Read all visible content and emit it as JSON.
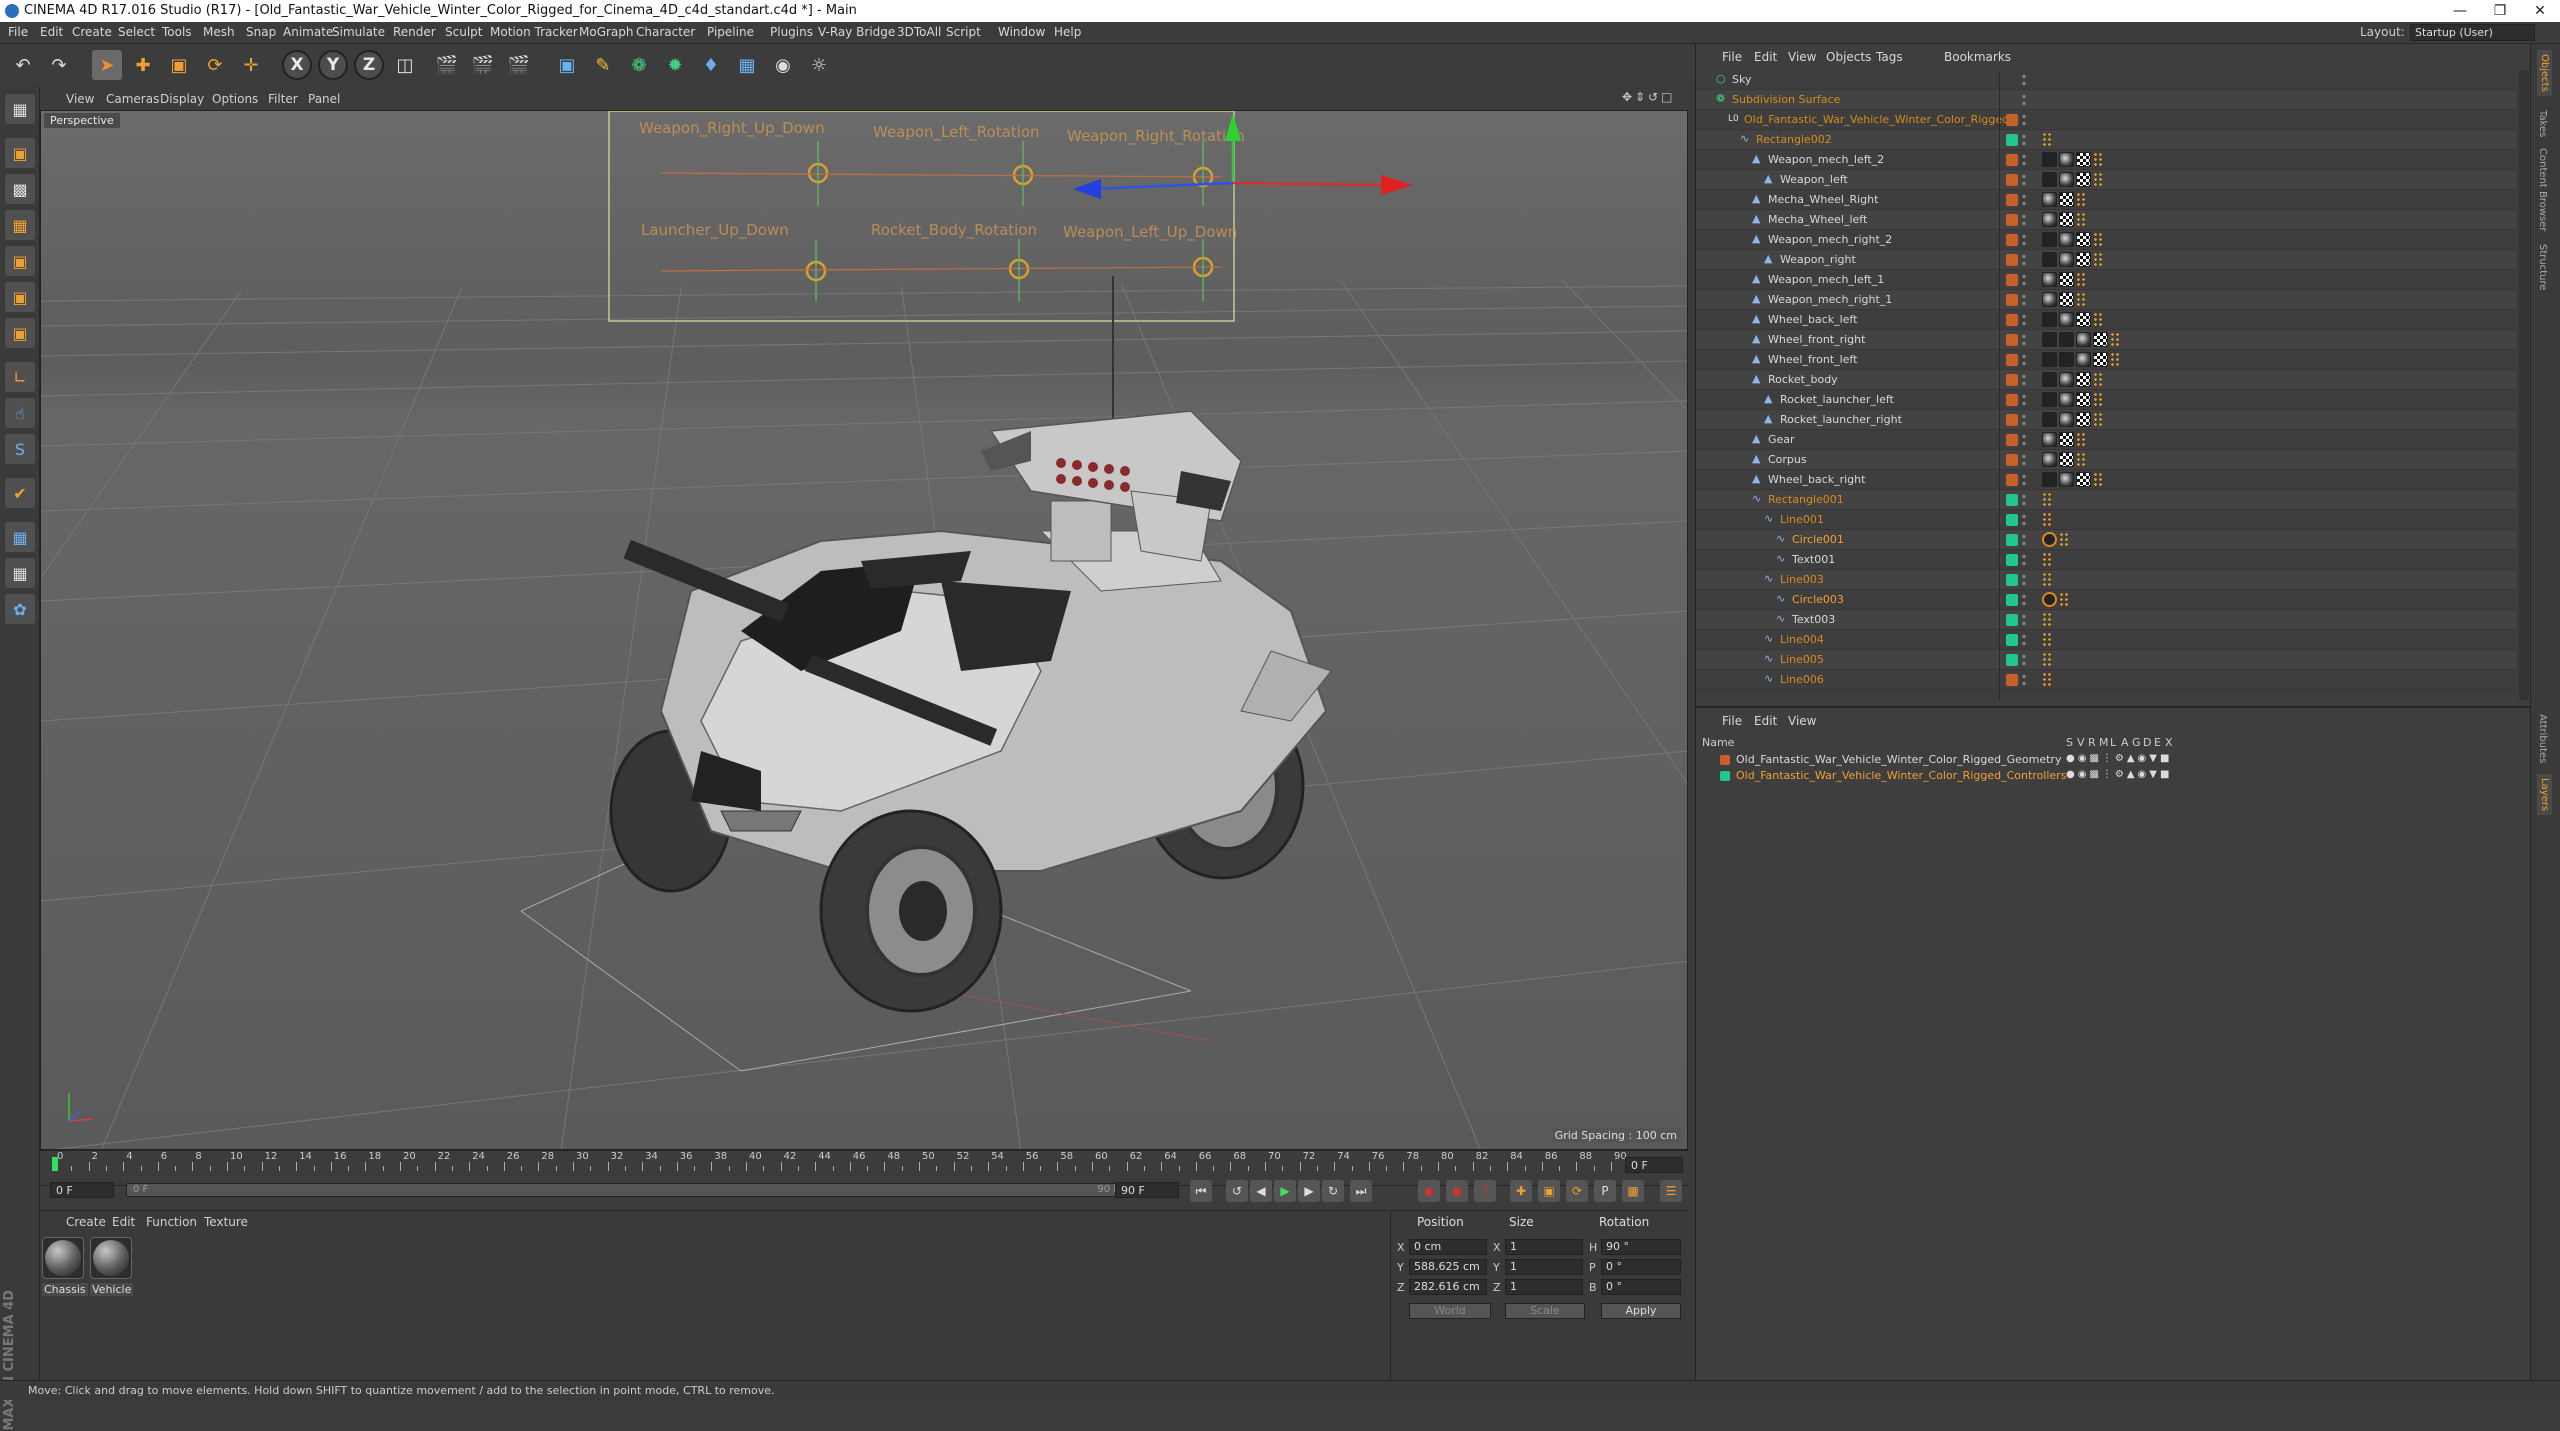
{
  "window": {
    "title": "CINEMA 4D R17.016 Studio (R17) - [Old_Fantastic_War_Vehicle_Winter_Color_Rigged_for_Cinema_4D_c4d_standart.c4d *] - Main"
  },
  "menu": [
    "File",
    "Edit",
    "Create",
    "Select",
    "Tools",
    "Mesh",
    "Snap",
    "Animate",
    "Simulate",
    "Render",
    "Sculpt",
    "Motion Tracker",
    "MoGraph",
    "Character",
    "Pipeline",
    "Plugins",
    "V-Ray Bridge",
    "3DToAll",
    "Script",
    "Window",
    "Help"
  ],
  "layout": {
    "label": "Layout:",
    "value": "Startup (User)"
  },
  "viewport": {
    "menu": [
      "View",
      "Cameras",
      "Display",
      "Options",
      "Filter",
      "Panel"
    ],
    "camera": "Perspective",
    "grid_spacing": "Grid Spacing : 100 cm",
    "rig_labels": [
      "Weapon_Right_Up_Down",
      "Weapon_Left_Rotation",
      "Weapon_Right_Rotation",
      "Launcher_Up_Down",
      "Rocket_Body_Rotation",
      "Weapon_Left_Up_Down"
    ]
  },
  "timeline": {
    "ticks": [
      "0",
      "2",
      "4",
      "6",
      "8",
      "10",
      "12",
      "14",
      "16",
      "18",
      "20",
      "22",
      "24",
      "26",
      "28",
      "30",
      "32",
      "34",
      "36",
      "38",
      "40",
      "42",
      "44",
      "46",
      "48",
      "50",
      "52",
      "54",
      "56",
      "58",
      "60",
      "62",
      "64",
      "66",
      "68",
      "70",
      "72",
      "74",
      "76",
      "78",
      "80",
      "82",
      "84",
      "86",
      "88",
      "90"
    ],
    "current_frame": "0 F",
    "start_frame": "0 F",
    "range_start": "0 F",
    "range_end": "90 F",
    "end_frame": "90 F"
  },
  "material_manager": {
    "menu": [
      "Create",
      "Edit",
      "Function",
      "Texture"
    ],
    "materials": [
      "Chassis",
      "Vehicle"
    ]
  },
  "coordinates": {
    "headers": [
      "Position",
      "Size",
      "Rotation"
    ],
    "rows": [
      {
        "axis": "X",
        "pos": "0 cm",
        "size_axis": "X",
        "size": "1",
        "rot_axis": "H",
        "rot": "90 °"
      },
      {
        "axis": "Y",
        "pos": "588.625 cm",
        "size_axis": "Y",
        "size": "1",
        "rot_axis": "P",
        "rot": "0 °"
      },
      {
        "axis": "Z",
        "pos": "282.616 cm",
        "size_axis": "Z",
        "size": "1",
        "rot_axis": "B",
        "rot": "0 °"
      }
    ],
    "mode": "World",
    "size_mode": "Scale",
    "apply": "Apply"
  },
  "object_manager": {
    "menu": [
      "File",
      "Edit",
      "View",
      "Objects",
      "Tags",
      "Bookmarks"
    ],
    "objects": [
      {
        "name": "Sky",
        "depth": 0,
        "style": "normal",
        "color": "",
        "tags": "",
        "icon": "sky-icon"
      },
      {
        "name": "Subdivision Surface",
        "depth": 0,
        "style": "orange",
        "color": "",
        "tags": "",
        "icon": "subdiv-icon"
      },
      {
        "name": "Old_Fantastic_War_Vehicle_Winter_Color_Rigged",
        "depth": 1,
        "style": "orange",
        "color": "#c8602a",
        "tags": "",
        "icon": "null-icon"
      },
      {
        "name": "Rectangle002",
        "depth": 2,
        "style": "orange",
        "color": "#22c88a",
        "tags": "d",
        "icon": "spline-icon"
      },
      {
        "name": "Weapon_mech_left_2",
        "depth": 3,
        "style": "normal",
        "color": "#c8602a",
        "tags": "xpcd",
        "icon": "poly-icon"
      },
      {
        "name": "Weapon_left",
        "depth": 4,
        "style": "normal",
        "color": "#c8602a",
        "tags": "xpcd",
        "icon": "poly-icon"
      },
      {
        "name": "Mecha_Wheel_Right",
        "depth": 3,
        "style": "normal",
        "color": "#c8602a",
        "tags": "pcd",
        "icon": "poly-icon"
      },
      {
        "name": "Mecha_Wheel_left",
        "depth": 3,
        "style": "normal",
        "color": "#c8602a",
        "tags": "pcd",
        "icon": "poly-icon"
      },
      {
        "name": "Weapon_mech_right_2",
        "depth": 3,
        "style": "normal",
        "color": "#c8602a",
        "tags": "xpcd",
        "icon": "poly-icon"
      },
      {
        "name": "Weapon_right",
        "depth": 4,
        "style": "normal",
        "color": "#c8602a",
        "tags": "xpcd",
        "icon": "poly-icon"
      },
      {
        "name": "Weapon_mech_left_1",
        "depth": 3,
        "style": "normal",
        "color": "#c8602a",
        "tags": "pcd",
        "icon": "poly-icon"
      },
      {
        "name": "Weapon_mech_right_1",
        "depth": 3,
        "style": "normal",
        "color": "#c8602a",
        "tags": "pcd",
        "icon": "poly-icon"
      },
      {
        "name": "Wheel_back_left",
        "depth": 3,
        "style": "normal",
        "color": "#c8602a",
        "tags": "xpcd",
        "icon": "poly-icon"
      },
      {
        "name": "Wheel_front_right",
        "depth": 3,
        "style": "normal",
        "color": "#c8602a",
        "tags": "xxpcd",
        "icon": "poly-icon"
      },
      {
        "name": "Wheel_front_left",
        "depth": 3,
        "style": "normal",
        "color": "#c8602a",
        "tags": "xxpcd",
        "icon": "poly-icon"
      },
      {
        "name": "Rocket_body",
        "depth": 3,
        "style": "normal",
        "color": "#c8602a",
        "tags": "xpcd",
        "icon": "poly-icon"
      },
      {
        "name": "Rocket_launcher_left",
        "depth": 4,
        "style": "normal",
        "color": "#c8602a",
        "tags": "xpcd",
        "icon": "poly-icon"
      },
      {
        "name": "Rocket_launcher_right",
        "depth": 4,
        "style": "normal",
        "color": "#c8602a",
        "tags": "xpcd",
        "icon": "poly-icon"
      },
      {
        "name": "Gear",
        "depth": 3,
        "style": "normal",
        "color": "#c8602a",
        "tags": "pcd",
        "icon": "poly-icon"
      },
      {
        "name": "Corpus",
        "depth": 3,
        "style": "normal",
        "color": "#c8602a",
        "tags": "pcd",
        "icon": "poly-icon"
      },
      {
        "name": "Wheel_back_right",
        "depth": 3,
        "style": "normal",
        "color": "#c8602a",
        "tags": "xpcd",
        "icon": "poly-icon"
      },
      {
        "name": "Rectangle001",
        "depth": 3,
        "style": "orange",
        "color": "#22c88a",
        "tags": "d",
        "icon": "spline-icon"
      },
      {
        "name": "Line001",
        "depth": 4,
        "style": "orange",
        "color": "#22c88a",
        "tags": "d",
        "icon": "spline-icon"
      },
      {
        "name": "Circle001",
        "depth": 5,
        "style": "hi",
        "color": "#22c88a",
        "tags": "nd",
        "icon": "spline-icon"
      },
      {
        "name": "Text001",
        "depth": 5,
        "style": "normal",
        "color": "#22c88a",
        "tags": "d",
        "icon": "spline-icon"
      },
      {
        "name": "Line003",
        "depth": 4,
        "style": "orange",
        "color": "#22c88a",
        "tags": "d",
        "icon": "spline-icon"
      },
      {
        "name": "Circle003",
        "depth": 5,
        "style": "hi",
        "color": "#22c88a",
        "tags": "nd",
        "icon": "spline-icon"
      },
      {
        "name": "Text003",
        "depth": 5,
        "style": "normal",
        "color": "#22c88a",
        "tags": "d",
        "icon": "spline-icon"
      },
      {
        "name": "Line004",
        "depth": 4,
        "style": "orange",
        "color": "#22c88a",
        "tags": "d",
        "icon": "spline-icon"
      },
      {
        "name": "Line005",
        "depth": 4,
        "style": "orange",
        "color": "#22c88a",
        "tags": "d",
        "icon": "spline-icon"
      },
      {
        "name": "Line006",
        "depth": 4,
        "style": "orange",
        "color": "#c8602a",
        "tags": "d",
        "icon": "spline-icon"
      }
    ]
  },
  "layer_manager": {
    "menu": [
      "File",
      "Edit",
      "View"
    ],
    "name_header": "Name",
    "col_headers": [
      "S",
      "V",
      "R",
      "M",
      "L",
      "A",
      "G",
      "D",
      "E",
      "X"
    ],
    "layers": [
      {
        "name": "Old_Fantastic_War_Vehicle_Winter_Color_Rigged_Geometry",
        "color": "#c8602a",
        "text_color": "#d8d8d8"
      },
      {
        "name": "Old_Fantastic_War_Vehicle_Winter_Color_Rigged_Controllers",
        "color": "#22c88a",
        "text_color": "#f0a030"
      }
    ]
  },
  "right_tabs": [
    "Objects",
    "Takes",
    "Content Browser",
    "Structure",
    "Attributes",
    "Layers"
  ],
  "status": "Move: Click and drag to move elements. Hold down SHIFT to quantize movement / add to the selection in point mode, CTRL to remove."
}
